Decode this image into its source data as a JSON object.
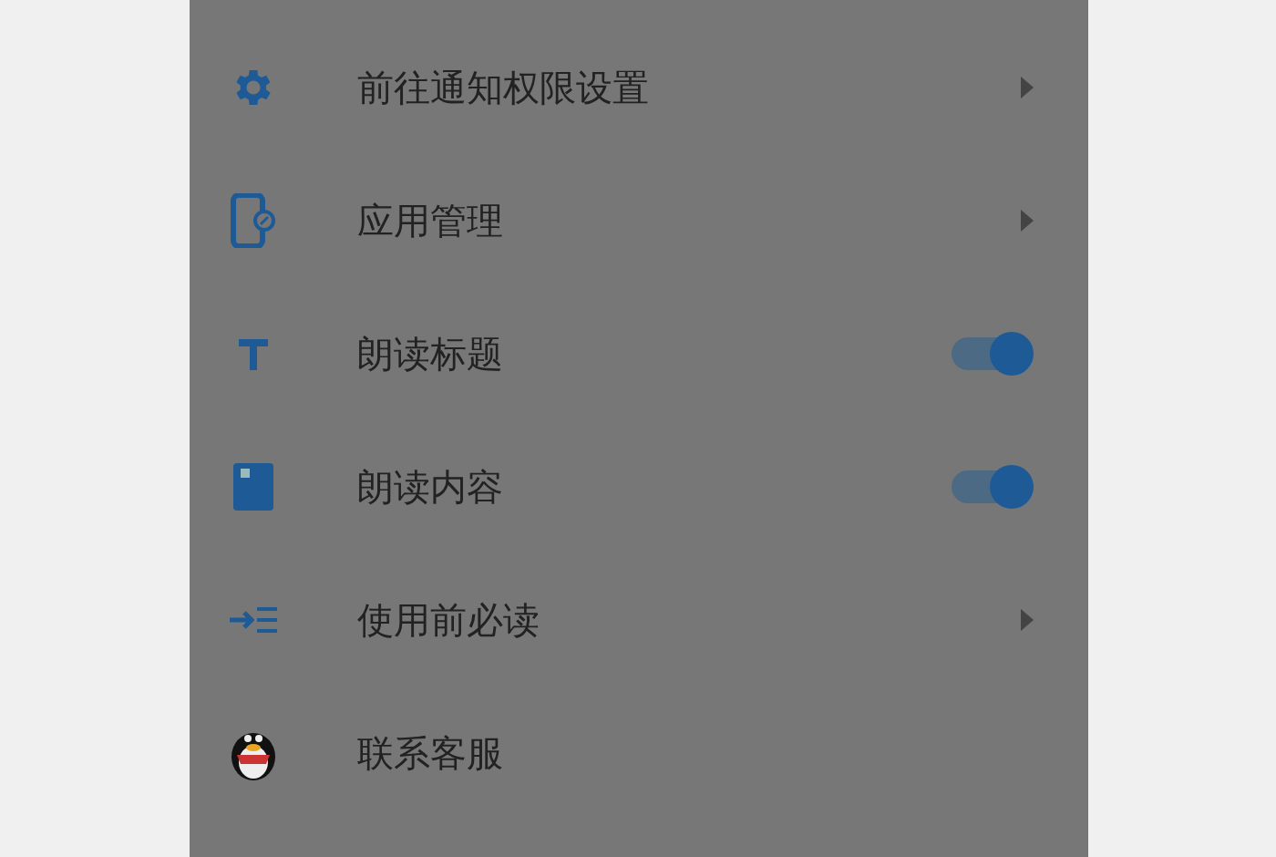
{
  "menu": {
    "items": [
      {
        "label": "前往通知权限设置",
        "kind": "link"
      },
      {
        "label": "应用管理",
        "kind": "link"
      },
      {
        "label": "朗读标题",
        "kind": "toggle",
        "on": true
      },
      {
        "label": "朗读内容",
        "kind": "toggle",
        "on": true
      },
      {
        "label": "使用前必读",
        "kind": "link"
      },
      {
        "label": "联系客服",
        "kind": "plain"
      }
    ]
  }
}
